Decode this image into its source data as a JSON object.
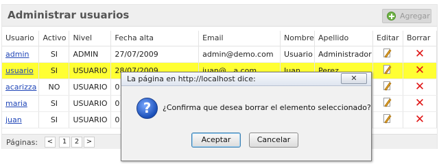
{
  "panel": {
    "title": "Administrar usuarios",
    "add_label": "Agregar"
  },
  "table": {
    "headers": [
      "Usuario",
      "Activo",
      "Nivel",
      "Fecha alta",
      "Email",
      "Nombre",
      "Apellido",
      "Editar",
      "Borrar"
    ],
    "rows": [
      {
        "usuario": "admin",
        "activo": "SI",
        "nivel": "ADMIN",
        "fecha": "27/07/2009",
        "email": "admin@demo.com",
        "nombre": "Usuario",
        "apellido": "Administrador"
      },
      {
        "usuario": "usuario",
        "activo": "SI",
        "nivel": "USUARIO",
        "fecha": "28/07/2009",
        "email": "juan@...a.com",
        "nombre": "Juan",
        "apellido": "Perez"
      },
      {
        "usuario": "acarizza",
        "activo": "NO",
        "nivel": "USUARIO",
        "fecha": "0",
        "email": "",
        "nombre": "",
        "apellido": ""
      },
      {
        "usuario": "maria",
        "activo": "SI",
        "nivel": "USUARIO",
        "fecha": "0",
        "email": "",
        "nombre": "",
        "apellido": ""
      },
      {
        "usuario": "juan",
        "activo": "SI",
        "nivel": "USUARIO",
        "fecha": "0",
        "email": "",
        "nombre": "",
        "apellido": ""
      }
    ]
  },
  "pager": {
    "label": "Páginas:",
    "prev": "<",
    "pages": [
      "1",
      "2"
    ],
    "next": ">"
  },
  "dialog": {
    "title": "La página en http://localhost dice:",
    "close_label": "✕",
    "icon_char": "?",
    "message": "¿Confirma que desea borrar el elemento seleccionado?",
    "ok_label": "Aceptar",
    "cancel_label": "Cancelar"
  },
  "colors": {
    "highlight_row": "#ffff33",
    "link": "#1f45b7",
    "delete": "#e01616"
  },
  "icons": {
    "add": "plus-circle-icon",
    "edit": "edit-document-icon",
    "delete": "red-x-icon",
    "question": "question-icon"
  }
}
